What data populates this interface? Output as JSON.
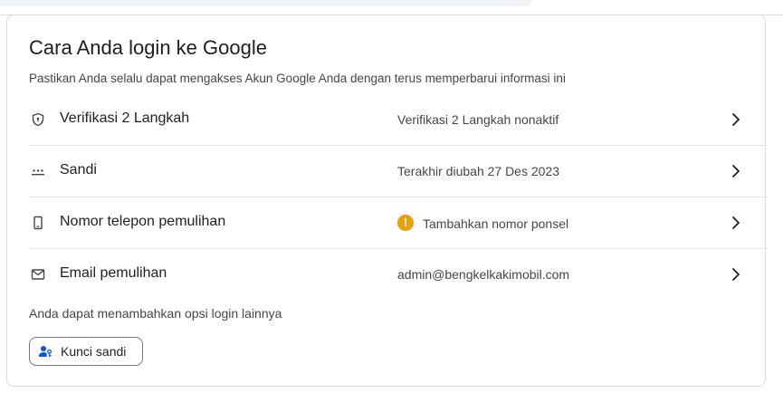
{
  "section": {
    "title": "Cara Anda login ke Google",
    "subtitle": "Pastikan Anda selalu dapat mengakses Akun Google Anda dengan terus memperbarui informasi ini"
  },
  "rows": [
    {
      "icon": "shield-icon",
      "label": "Verifikasi 2 Langkah",
      "value": "Verifikasi 2 Langkah nonaktif"
    },
    {
      "icon": "password-dots-icon",
      "label": "Sandi",
      "value": "Terakhir diubah 27 Des 2023"
    },
    {
      "icon": "phone-icon",
      "label": "Nomor telepon pemulihan",
      "value": "Tambahkan nomor ponsel",
      "value_icon": "warning-icon",
      "warning_glyph": "!"
    },
    {
      "icon": "mail-icon",
      "label": "Email pemulihan",
      "value": "admin@bengkelkakimobil.com"
    }
  ],
  "more_options_text": "Anda dapat menambahkan opsi login lainnya",
  "passkey_button": {
    "icon": "passkey-icon",
    "label": "Kunci sandi"
  },
  "colors": {
    "warning": "#e8a10c",
    "accent": "#0b57d0",
    "border": "#dadce0"
  }
}
